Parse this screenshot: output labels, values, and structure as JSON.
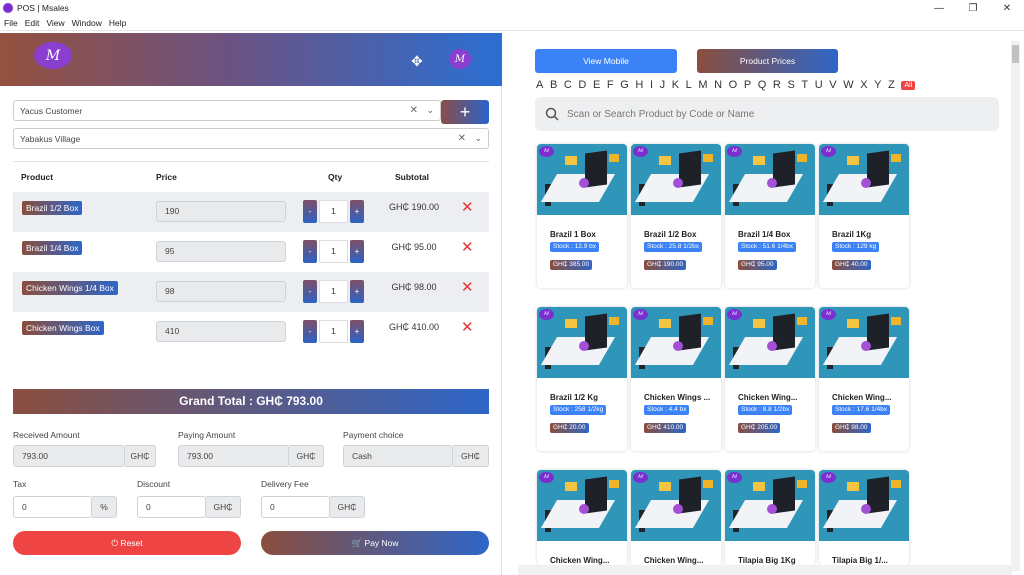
{
  "window": {
    "title": "POS | Msales",
    "minimize": "—",
    "maximize": "❐",
    "close": "✕"
  },
  "menu": [
    "File",
    "Edit",
    "View",
    "Window",
    "Help"
  ],
  "header": {
    "logo_text": "M",
    "move_icon": "✥",
    "avatar_text": "M"
  },
  "customer": {
    "value": "Yacus Customer",
    "clear": "✕",
    "chevron": "⌄",
    "add_label": "+"
  },
  "location": {
    "value": "Yabakus Village",
    "clear": "✕",
    "chevron": "⌄"
  },
  "table": {
    "headers": {
      "product": "Product",
      "price": "Price",
      "qty": "Qty",
      "subtotal": "Subtotal"
    },
    "rows": [
      {
        "name": "Brazil 1/2 Box",
        "price": "190",
        "qty": "1",
        "subtotal": "GH₵ 190.00"
      },
      {
        "name": "Brazil 1/4 Box",
        "price": "95",
        "qty": "1",
        "subtotal": "GH₵ 95.00"
      },
      {
        "name": "Chicken Wings 1/4 Box",
        "price": "98",
        "qty": "1",
        "subtotal": "GH₵ 98.00"
      },
      {
        "name": "Chicken Wings  Box",
        "price": "410",
        "qty": "1",
        "subtotal": "GH₵ 410.00"
      }
    ],
    "minus": "-",
    "plus": "+",
    "delete": "✕"
  },
  "grand_total": "Grand Total : GH₵ 793.00",
  "fields": {
    "received": {
      "label": "Received Amount",
      "value": "793.00",
      "suffix": "GH₵"
    },
    "paying": {
      "label": "Paying Amount",
      "value": "793.00",
      "suffix": "GH₵"
    },
    "payment": {
      "label": "Payment choice",
      "value": "Cash",
      "suffix": "GH₵"
    },
    "tax": {
      "label": "Tax",
      "value": "0",
      "suffix": "%"
    },
    "discount": {
      "label": "Discount",
      "value": "0",
      "suffix": "GH₵"
    },
    "delivery": {
      "label": "Delivery Fee",
      "value": "0",
      "suffix": "GH₵"
    }
  },
  "buttons": {
    "reset": "⏻ Reset",
    "pay": "🛒 Pay Now",
    "view_mobile": "View Mobile",
    "product_prices": "Product Prices"
  },
  "alphabet": [
    "A",
    "B",
    "C",
    "D",
    "E",
    "F",
    "G",
    "H",
    "I",
    "J",
    "K",
    "L",
    "M",
    "N",
    "O",
    "P",
    "Q",
    "R",
    "S",
    "T",
    "U",
    "V",
    "W",
    "X",
    "Y",
    "Z"
  ],
  "alphabet_all": "All",
  "search": {
    "placeholder": "Scan or Search Product by Code or Name"
  },
  "products": [
    {
      "name": "Brazil 1 Box",
      "stock": "Stock : 12.9 bx",
      "price": "GH₵ 385.00"
    },
    {
      "name": "Brazil 1/2 Box",
      "stock": "Stock : 25.8 1/2bx",
      "price": "GH₵ 190.00"
    },
    {
      "name": "Brazil 1/4 Box",
      "stock": "Stock : 51.6 1/4bx",
      "price": "GH₵ 95.00"
    },
    {
      "name": "Brazil 1Kg",
      "stock": "Stock : 129 kg",
      "price": "GH₵ 40.00"
    },
    {
      "name": "Brazil 1/2 Kg",
      "stock": "Stock : 258 1/2kg",
      "price": "GH₵ 20.00"
    },
    {
      "name": "Chicken Wings ...",
      "stock": "Stock : 4.4 bx",
      "price": "GH₵ 410.00"
    },
    {
      "name": "Chicken Wing...",
      "stock": "Stock : 8.8 1/2bx",
      "price": "GH₵ 205.00"
    },
    {
      "name": "Chicken Wing...",
      "stock": "Stock : 17.6 1/4bx",
      "price": "GH₵ 98.00"
    },
    {
      "name": "Chicken Wing...",
      "stock": "",
      "price": ""
    },
    {
      "name": "Chicken Wing...",
      "stock": "",
      "price": ""
    },
    {
      "name": "Tilapia Big 1Kg",
      "stock": "",
      "price": ""
    },
    {
      "name": "Tilapia Big 1/...",
      "stock": "",
      "price": ""
    }
  ],
  "product_logo_text": "M"
}
